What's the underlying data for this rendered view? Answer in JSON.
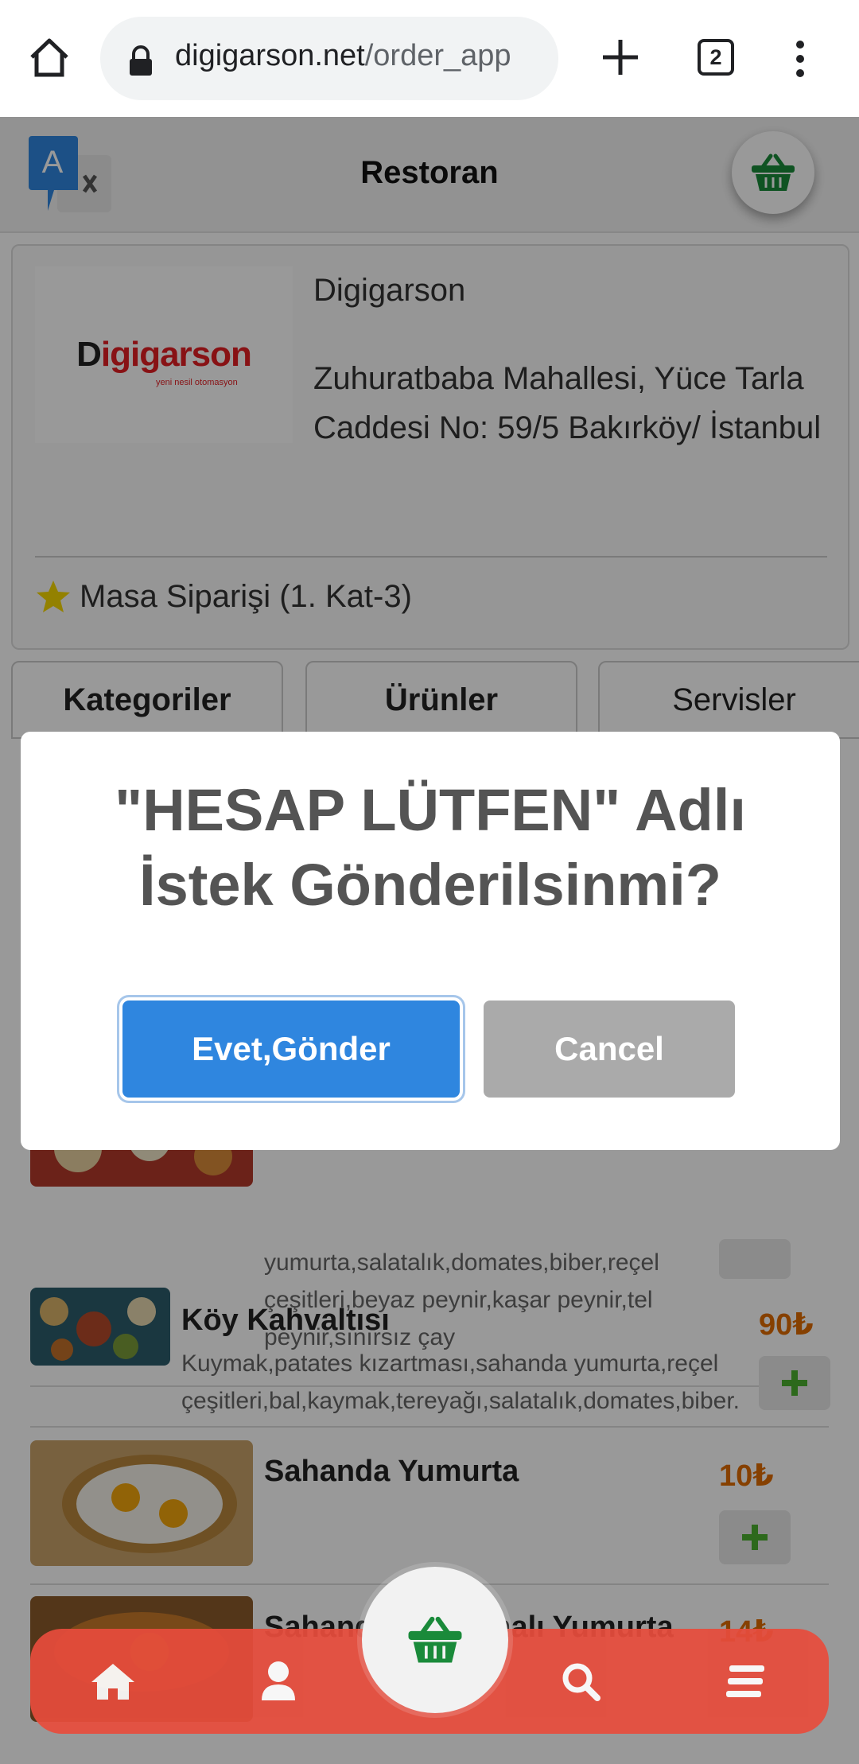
{
  "browser": {
    "url_domain": "digigarson.net",
    "url_path": "/order_app",
    "tab_count": "2"
  },
  "header": {
    "title": "Restoran"
  },
  "restaurant": {
    "logo_text_prefix": "D",
    "logo_text_rest": "igigarson",
    "logo_tagline": "yeni nesil otomasyon",
    "name": "Digigarson",
    "address": "Zuhuratbaba Mahallesi, Yüce Tarla Caddesi No: 59/5 Bakırköy/ İstanbul",
    "order_type": "Masa Siparişi (1. Kat-3)"
  },
  "tabs": [
    {
      "label": "Kategoriler"
    },
    {
      "label": "Ürünler"
    },
    {
      "label": "Servisler"
    }
  ],
  "products": [
    {
      "name": "",
      "description": "yumurta,salatalık,domates,biber,reçel çeşitleri,beyaz peynir,kaşar peynir,tel peynir,sınırsız çay",
      "price": ""
    },
    {
      "name": "Köy Kahvaltısı",
      "description": "Kuymak,patates kızartması,sahanda yumurta,reçel çeşitleri,bal,kaymak,tereyağı,salatalık,domates,biber.",
      "price": "90₺"
    },
    {
      "name": "Sahanda Yumurta",
      "description": "",
      "price": "10₺"
    },
    {
      "name": "Sahanda Kavurmalı Yumurta",
      "description": "",
      "price": "14₺"
    }
  ],
  "dialog": {
    "title": "\"HESAP LÜTFEN\" Adlı İstek Gönderilsinmi?",
    "confirm_label": "Evet,Gönder",
    "cancel_label": "Cancel"
  },
  "colors": {
    "accent_blue": "#2f86df",
    "nav_red": "#e74c3c",
    "basket_green": "#1a8a3a",
    "price_orange": "#e06c00",
    "add_green": "#4caf30"
  },
  "icons": {
    "home": "home-icon",
    "user": "user-icon",
    "search": "search-icon",
    "menu": "menu-icon",
    "basket": "basket-icon",
    "translate": "translate-icon",
    "star": "star-icon"
  }
}
